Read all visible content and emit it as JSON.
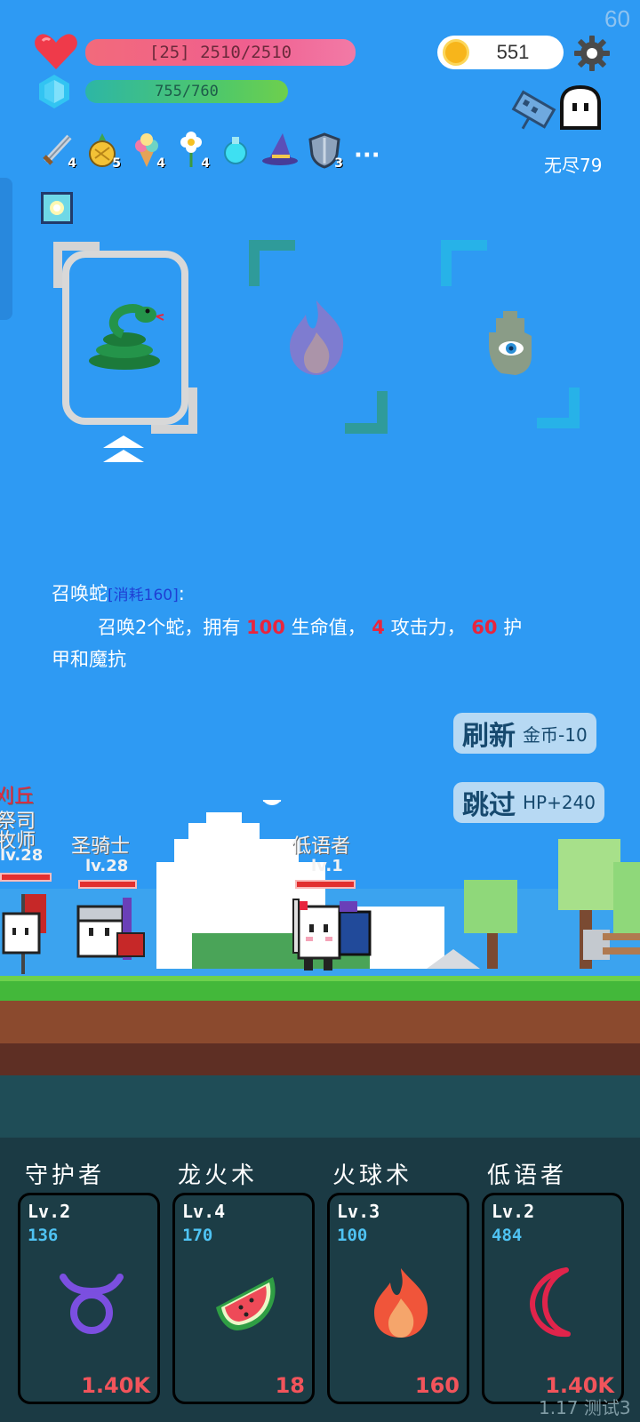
{
  "fps": "60",
  "player": {
    "hp_text": "[25] 2510/2510",
    "mp_text": "755/760",
    "hp_fraction": 1.0,
    "mp_fraction": 0.993
  },
  "coins": "551",
  "mode": "无尽79",
  "items": [
    {
      "icon": "sword-icon",
      "count": "4"
    },
    {
      "icon": "pineapple-icon",
      "count": "5"
    },
    {
      "icon": "ice-cream-icon",
      "count": "4"
    },
    {
      "icon": "flower-icon",
      "count": "4"
    },
    {
      "icon": "potion-icon",
      "count": ""
    },
    {
      "icon": "wizard-hat-icon",
      "count": ""
    },
    {
      "icon": "shield-icon",
      "count": "3"
    }
  ],
  "more_label": "···",
  "skill_choice": {
    "name": "召唤蛇",
    "cost": "[消耗160]",
    "colon": ":",
    "desc_1": "召唤2个蛇，拥有",
    "hp": "100",
    "desc_2": "生命值，",
    "atk": "4",
    "desc_3": "攻击力，",
    "armor": "60",
    "desc_4": "护",
    "desc_5": "甲和魔抗"
  },
  "buttons": {
    "refresh_label": "刷新",
    "refresh_cost": "金币-10",
    "skip_label": "跳过",
    "skip_bonus": "HP+240"
  },
  "units": {
    "ally_name": "低语者",
    "ally_lv": "lv.1",
    "enemy_name_1": "祭司",
    "enemy_name_2": "牧师",
    "enemy_lv": "lv.28",
    "enemy_name_3": "圣骑士",
    "enemy_partial": "刈丘"
  },
  "slots": [
    {
      "title": "守护者",
      "lv": "Lv.2",
      "value": "136",
      "icon": "taurus-icon",
      "cost": "1.40K",
      "color": "#7b4fe0"
    },
    {
      "title": "龙火术",
      "lv": "Lv.4",
      "value": "170",
      "icon": "watermelon-icon",
      "cost": "18",
      "color": "#e84a55"
    },
    {
      "title": "火球术",
      "lv": "Lv.3",
      "value": "100",
      "icon": "fire-icon",
      "cost": "160",
      "color": "#f26a3b"
    },
    {
      "title": "低语者",
      "lv": "Lv.2",
      "value": "484",
      "icon": "crescent-moon-icon",
      "cost": "1.40K",
      "color": "#e0244b"
    }
  ],
  "version": "1.17 测试3"
}
